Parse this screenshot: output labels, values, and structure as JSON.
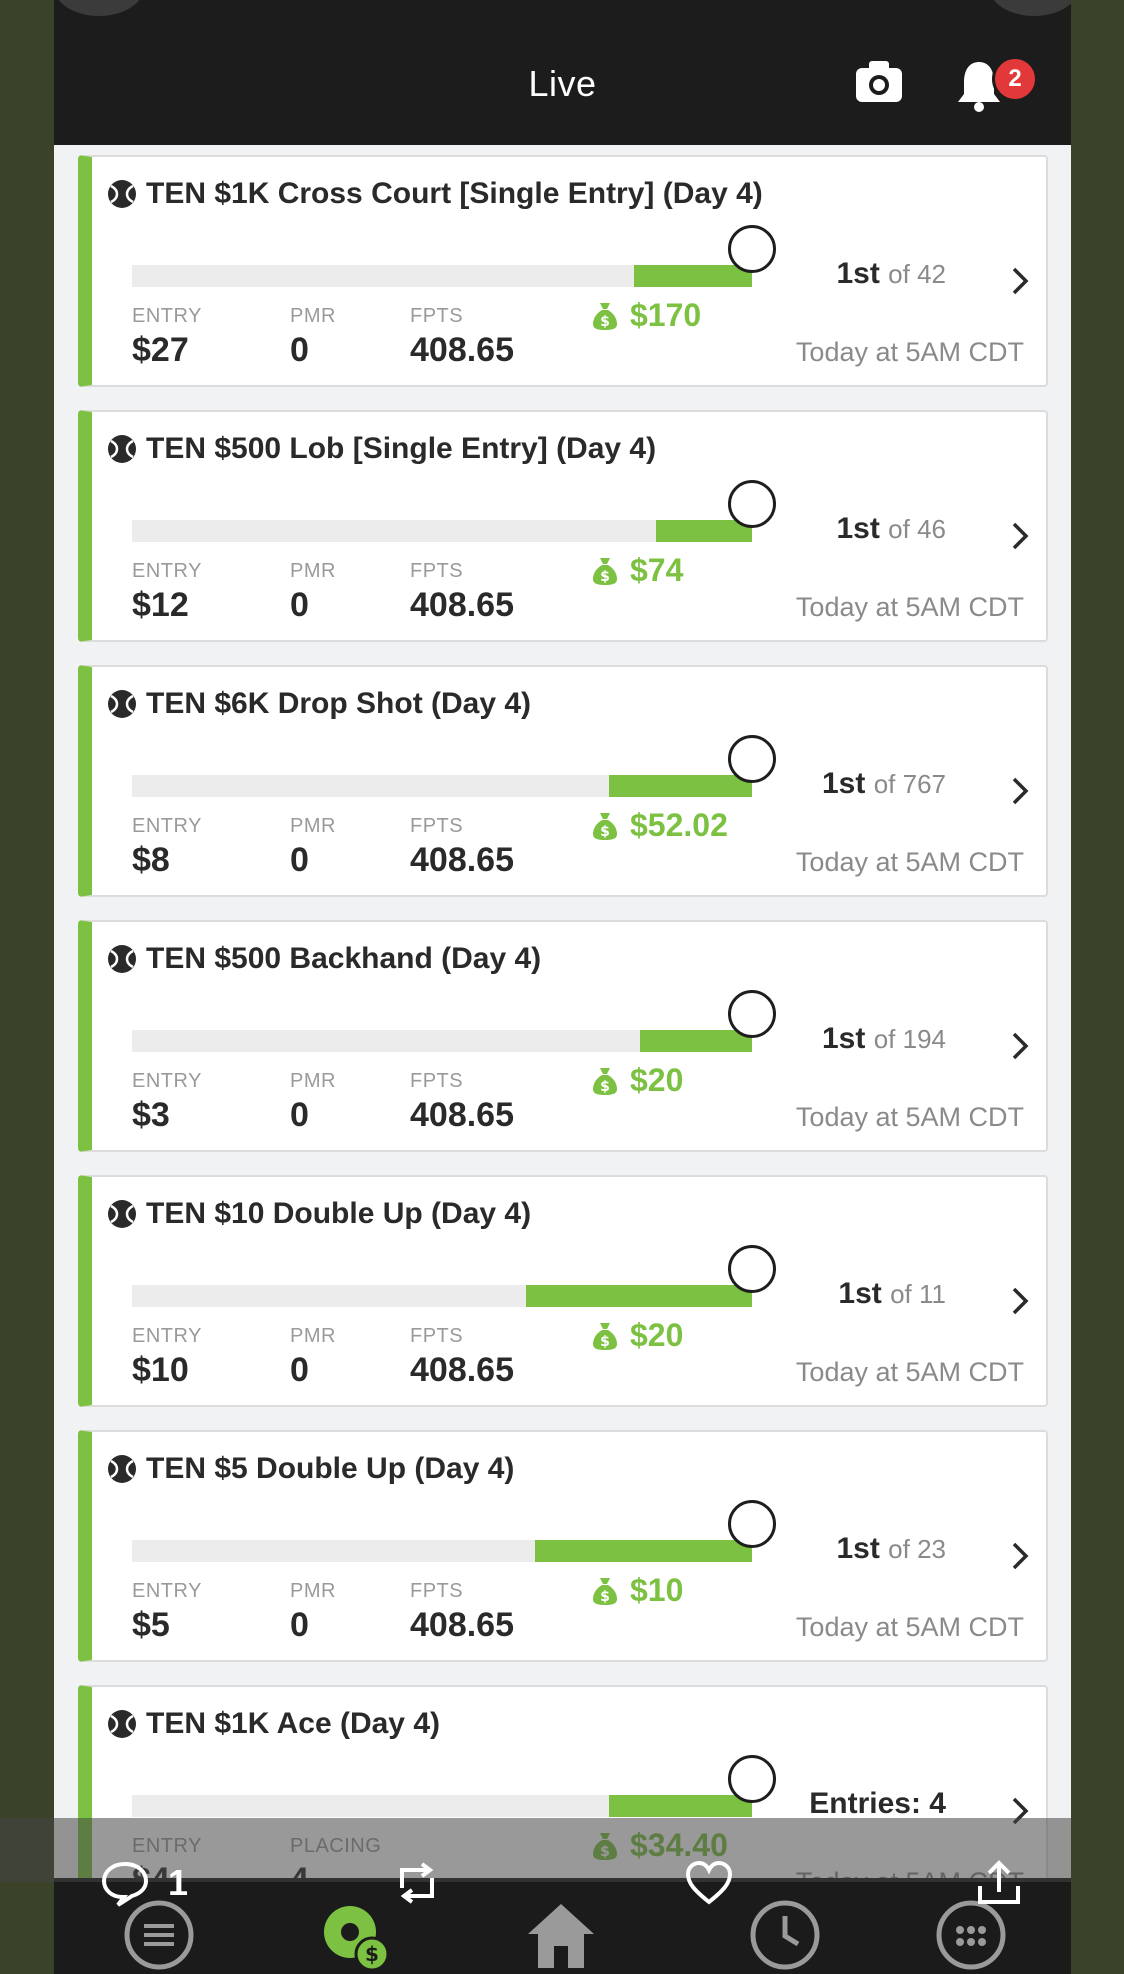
{
  "header": {
    "title": "Live",
    "notification_count": "2"
  },
  "cards": [
    {
      "title": "TEN $1K Cross Court [Single Entry] (Day 4)",
      "entry_label": "ENTRY",
      "entry": "$27",
      "mid_label": "PMR",
      "mid": "0",
      "fpts_label": "FPTS",
      "fpts": "408.65",
      "prize": "$170",
      "rank": "1st",
      "of": "of 42",
      "time": "Today at 5AM CDT",
      "progress": 0.19
    },
    {
      "title": "TEN $500 Lob [Single Entry] (Day 4)",
      "entry_label": "ENTRY",
      "entry": "$12",
      "mid_label": "PMR",
      "mid": "0",
      "fpts_label": "FPTS",
      "fpts": "408.65",
      "prize": "$74",
      "rank": "1st",
      "of": "of 46",
      "time": "Today at 5AM CDT",
      "progress": 0.155
    },
    {
      "title": "TEN $6K Drop Shot (Day 4)",
      "entry_label": "ENTRY",
      "entry": "$8",
      "mid_label": "PMR",
      "mid": "0",
      "fpts_label": "FPTS",
      "fpts": "408.65",
      "prize": "$52.02",
      "rank": "1st",
      "of": "of 767",
      "time": "Today at 5AM CDT",
      "progress": 0.23
    },
    {
      "title": "TEN $500 Backhand (Day 4)",
      "entry_label": "ENTRY",
      "entry": "$3",
      "mid_label": "PMR",
      "mid": "0",
      "fpts_label": "FPTS",
      "fpts": "408.65",
      "prize": "$20",
      "rank": "1st",
      "of": "of 194",
      "time": "Today at 5AM CDT",
      "progress": 0.18
    },
    {
      "title": "TEN $10 Double Up (Day 4)",
      "entry_label": "ENTRY",
      "entry": "$10",
      "mid_label": "PMR",
      "mid": "0",
      "fpts_label": "FPTS",
      "fpts": "408.65",
      "prize": "$20",
      "rank": "1st",
      "of": "of 11",
      "time": "Today at 5AM CDT",
      "progress": 0.365
    },
    {
      "title": "TEN $5 Double Up (Day 4)",
      "entry_label": "ENTRY",
      "entry": "$5",
      "mid_label": "PMR",
      "mid": "0",
      "fpts_label": "FPTS",
      "fpts": "408.65",
      "prize": "$10",
      "rank": "1st",
      "of": "of 23",
      "time": "Today at 5AM CDT",
      "progress": 0.35
    },
    {
      "title": "TEN $1K Ace (Day 4)",
      "entry_label": "ENTRY",
      "entry": "$4",
      "mid_label": "PLACING",
      "mid": "4",
      "fpts_label": "",
      "fpts": "",
      "prize": "$34.40",
      "rank": "Entries: 4",
      "of": "",
      "time": "Today at 5AM CDT",
      "progress": 0.23
    }
  ],
  "social": {
    "reply_count": "1"
  },
  "colors": {
    "accent": "#7cc142",
    "header": "#1c1c1c",
    "badge": "#e2383a"
  },
  "icons": [
    "camera-icon",
    "bell-icon",
    "tennis-ball-icon",
    "money-bag-icon",
    "chevron-right-icon",
    "menu-icon",
    "lobby-icon",
    "home-icon",
    "clock-icon",
    "more-icon",
    "reply-icon",
    "retweet-icon",
    "like-icon",
    "share-icon"
  ]
}
